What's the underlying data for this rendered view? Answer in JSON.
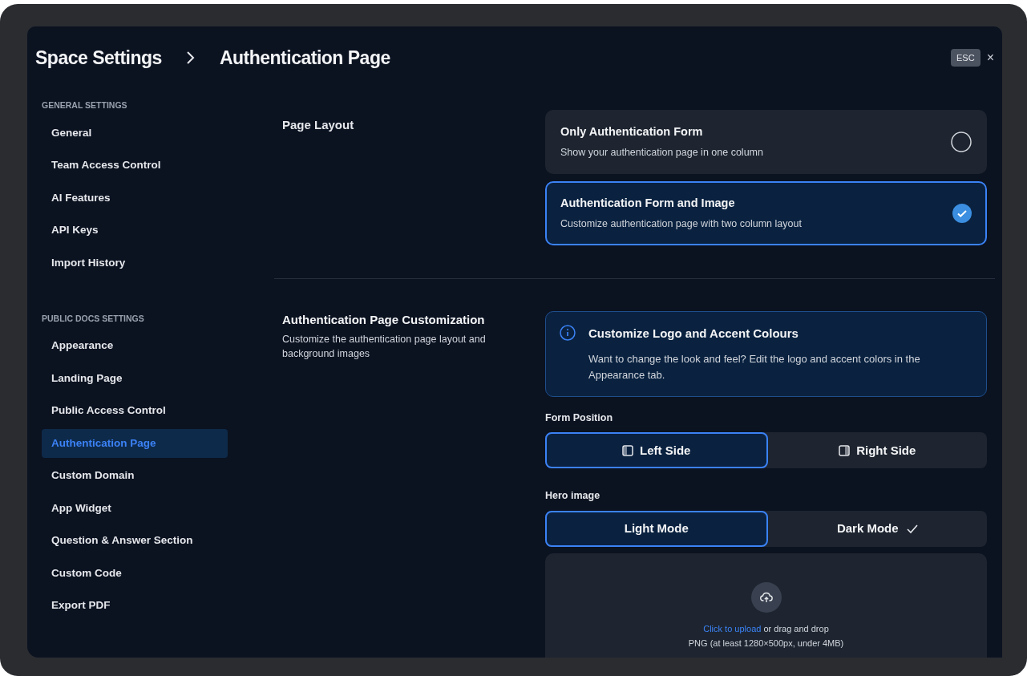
{
  "header": {
    "breadcrumb": [
      "Space Settings",
      "Authentication Page"
    ],
    "esc_key": "ESC",
    "close": "×"
  },
  "sidebar": {
    "sections": [
      {
        "title": "GENERAL SETTINGS",
        "items": [
          {
            "label": "General",
            "selected": false
          },
          {
            "label": "Team Access Control",
            "selected": false
          },
          {
            "label": "AI Features",
            "selected": false
          },
          {
            "label": "API Keys",
            "selected": false
          },
          {
            "label": "Import History",
            "selected": false
          }
        ]
      },
      {
        "title": "PUBLIC DOCS SETTINGS",
        "items": [
          {
            "label": "Appearance",
            "selected": false
          },
          {
            "label": "Landing Page",
            "selected": false
          },
          {
            "label": "Public Access Control",
            "selected": false
          },
          {
            "label": "Authentication Page",
            "selected": true
          },
          {
            "label": "Custom Domain",
            "selected": false
          },
          {
            "label": "App Widget",
            "selected": false
          },
          {
            "label": "Question & Answer Section",
            "selected": false
          },
          {
            "label": "Custom Code",
            "selected": false
          },
          {
            "label": "Export PDF",
            "selected": false
          }
        ]
      }
    ]
  },
  "page_layout": {
    "title": "Page Layout",
    "options": [
      {
        "title": "Only Authentication Form",
        "description": "Show your authentication page in one column",
        "selected": false
      },
      {
        "title": "Authentication Form and Image",
        "description": "Customize authentication page with two column layout",
        "selected": true
      }
    ]
  },
  "customization": {
    "title": "Authentication Page Customization",
    "description": "Customize the authentication page layout and background images",
    "info": {
      "title": "Customize Logo and Accent Colours",
      "text": "Want to change the look and feel? Edit the logo and accent colors in the Appearance tab."
    },
    "form_position": {
      "label": "Form Position",
      "options": [
        {
          "label": "Left Side",
          "kind": "left",
          "selected": true
        },
        {
          "label": "Right Side",
          "kind": "right",
          "selected": false
        }
      ]
    },
    "hero_image": {
      "label": "Hero image",
      "modes": [
        {
          "label": "Light Mode",
          "selected": true,
          "uploaded": false
        },
        {
          "label": "Dark Mode",
          "selected": false,
          "uploaded": true
        }
      ],
      "upload": {
        "link": "Click to upload",
        "text": "or drag and drop",
        "hint": "PNG (at least 1280×500px, under 4MB)"
      }
    }
  }
}
